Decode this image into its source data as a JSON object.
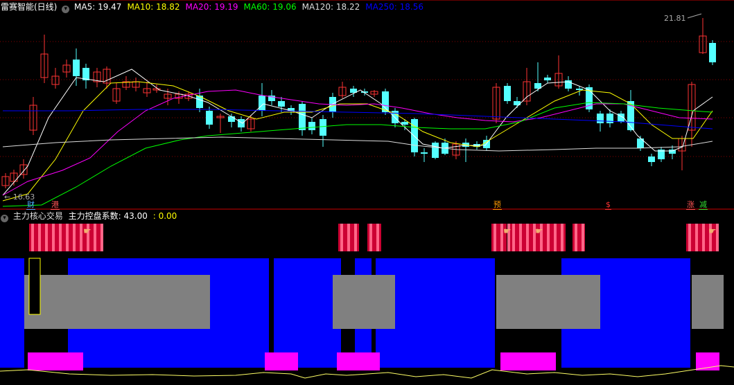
{
  "title": "雷赛智能(日线)",
  "ma_legend": [
    {
      "label": "MA5: 19.47",
      "color": "#ffffff"
    },
    {
      "label": "MA10: 18.82",
      "color": "#ffff00"
    },
    {
      "label": "MA20: 19.19",
      "color": "#ff00ff"
    },
    {
      "label": "MA60: 19.06",
      "color": "#00ff00"
    },
    {
      "label": "MA120: 18.22",
      "color": "#dddddd"
    },
    {
      "label": "MA250: 18.56",
      "color": "#0000ff"
    }
  ],
  "sub_panel": {
    "name": "主力核心交易",
    "indicator_label": "主力控盘系数: 43.00",
    "indicator_value": ": 0.00"
  },
  "event_tags": [
    {
      "label": "财",
      "color": "#4aa8ff"
    },
    {
      "label": "港",
      "color": "#ff5555"
    },
    {
      "label": "预",
      "color": "#ff9900"
    },
    {
      "label": "$",
      "color": "#ff3333"
    },
    {
      "label": "涨",
      "color": "#ff5555"
    },
    {
      "label": "减",
      "color": "#33dd33"
    }
  ],
  "colors": {
    "up": "#ff3333",
    "down": "#54ffff",
    "grid": "#8b0000",
    "separator": "#cc0000",
    "blue_block": "#0000ff",
    "gray_block": "#808080",
    "magenta_block": "#ff00ff",
    "yellow_line": "#ffff66"
  },
  "chart_data": {
    "type": "candlestick",
    "price_high_label": "21.81",
    "price_low_label": "16.63",
    "ma_series_names": [
      "MA5",
      "MA10",
      "MA20",
      "MA60",
      "MA120",
      "MA250"
    ]
  }
}
